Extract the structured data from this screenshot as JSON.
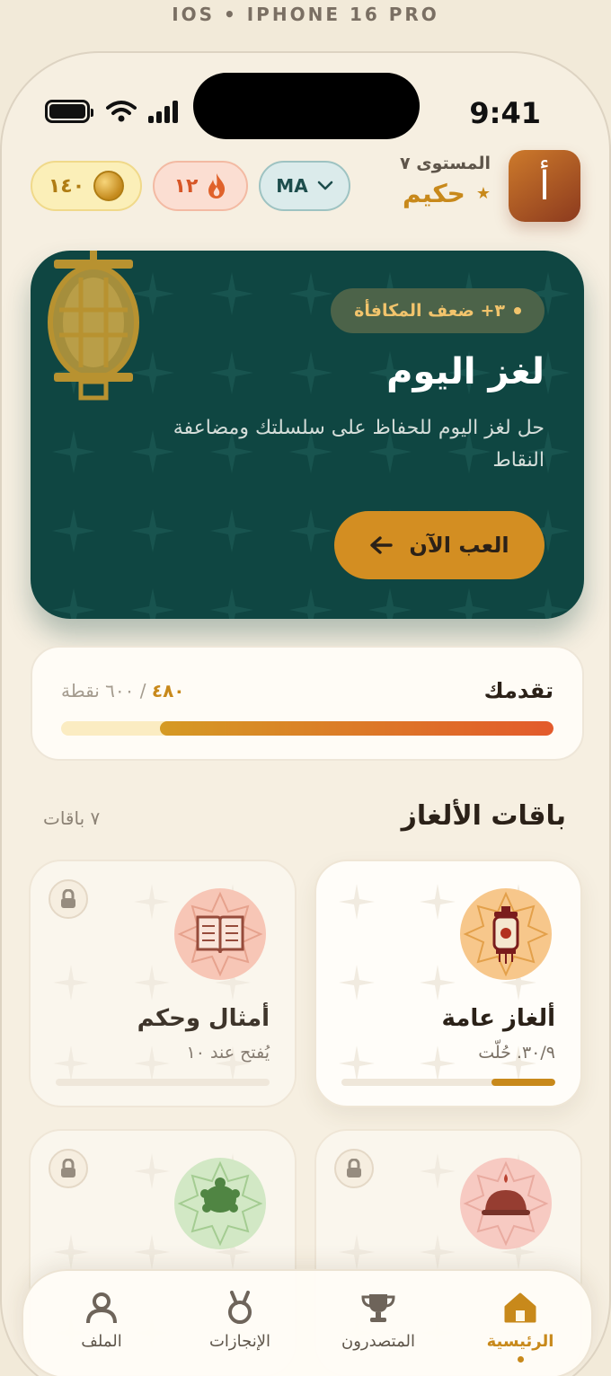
{
  "device_label": "IOS • IPHONE 16 PRO",
  "status_bar": {
    "time": "9:41"
  },
  "header": {
    "coins": "١٤٠",
    "streak": "١٢",
    "language": "MA",
    "level_label": "المستوى ٧",
    "rank": "حكيم",
    "avatar_letter": "أ"
  },
  "hero": {
    "bonus": "٣+ ضعف المكافأة",
    "title": "لغز اليوم",
    "description": "حل لغز اليوم للحفاظ على سلسلتك ومضاعفة النقاط",
    "button": "العب الآن"
  },
  "progress": {
    "label": "تقدمك",
    "current": "٤٨٠",
    "total": "/ ٦٠٠ نقطة",
    "fraction": 0.8
  },
  "packs_section": {
    "title": "باقات الألغاز",
    "count": "٧ باقات",
    "packs": [
      {
        "name": "ألغاز عامة",
        "sub": "٣٠/٩. حُلّت",
        "progress": 0.3,
        "locked": false,
        "icon": "lantern-icon"
      },
      {
        "name": "أمثال وحكم",
        "sub": "يُفتح عند ١٠",
        "progress": 0,
        "locked": true,
        "icon": "book-icon"
      },
      {
        "name": "",
        "sub": "",
        "progress": 0,
        "locked": true,
        "icon": "dish-icon"
      },
      {
        "name": "",
        "sub": "",
        "progress": 0,
        "locked": true,
        "icon": "turtle-icon"
      }
    ]
  },
  "tabbar": {
    "home": "الرئيسية",
    "leaders": "المتصدرون",
    "achievements": "الإنجازات",
    "profile": "الملف"
  },
  "colors": {
    "accent": "#c8891b",
    "hero_bg": "#0f4642",
    "background": "#f6efe1"
  }
}
